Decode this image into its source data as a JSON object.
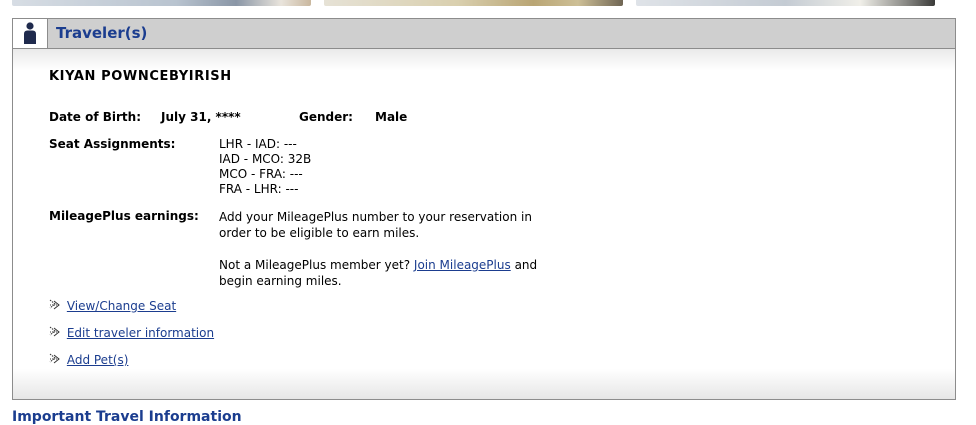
{
  "panel": {
    "title": "Traveler(s)",
    "icon": "person-icon",
    "header_color": "#cfcfcf",
    "title_color": "#1b3d8f"
  },
  "traveler": {
    "name": "KIYAN POWNCEBYIRISH",
    "dob_label": "Date of Birth:",
    "dob_value": "July 31, ****",
    "gender_label": "Gender:",
    "gender_value": "Male",
    "seat_label": "Seat Assignments:",
    "seats": [
      "LHR - IAD: ---",
      "IAD - MCO: 32B",
      "MCO - FRA: ---",
      "FRA - LHR: ---"
    ],
    "mileage_label": "MileagePlus earnings:",
    "mileage_line1": "Add your MileagePlus number to your reservation in",
    "mileage_line2": "order to be eligible to earn miles.",
    "member_prefix": "Not a MileagePlus member yet?",
    "join_link": "Join MileagePlus",
    "member_suffix": "and",
    "member_line2": "begin earning miles."
  },
  "actions": [
    {
      "label": "View/Change Seat",
      "icon": "arrow-right-icon"
    },
    {
      "label": "Edit traveler information",
      "icon": "arrow-right-icon"
    },
    {
      "label": "Add Pet(s)",
      "icon": "arrow-right-icon"
    }
  ],
  "next_section": {
    "heading": "Important Travel Information"
  }
}
